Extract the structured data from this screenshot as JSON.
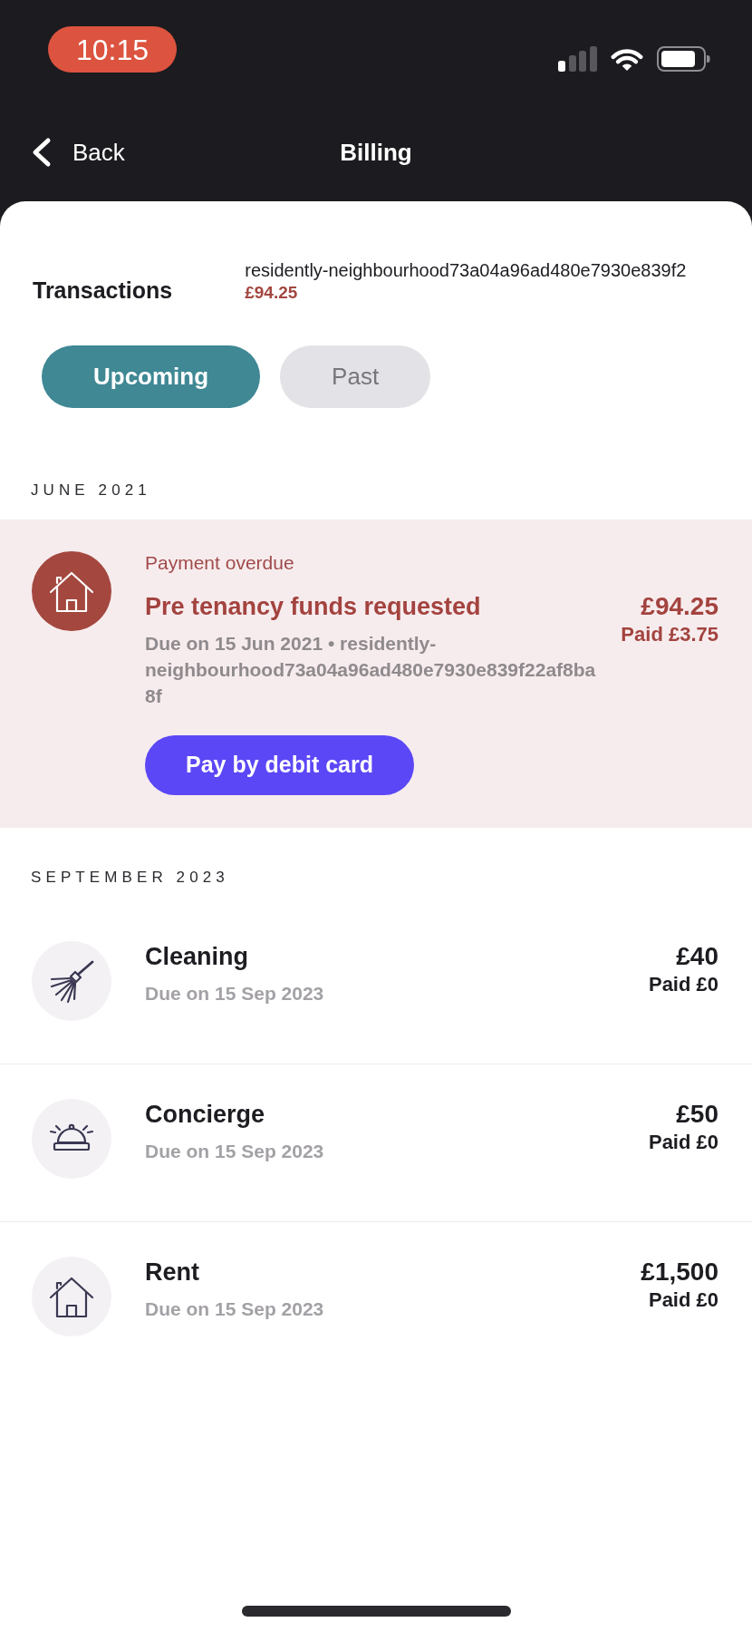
{
  "status_bar": {
    "time": "10:15"
  },
  "nav": {
    "back": "Back",
    "title": "Billing"
  },
  "transactions": {
    "title": "Transactions",
    "reference": "residently-neighbourhood73a04a96ad480e7930e839f2",
    "amount": "£94.25"
  },
  "tabs": [
    {
      "label": "Upcoming",
      "selected": true
    },
    {
      "label": "Past",
      "selected": false
    }
  ],
  "sections": [
    {
      "heading": "JUNE 2021",
      "items": [
        {
          "overdue": true,
          "status": "Payment overdue",
          "title": "Pre tenancy funds requested",
          "due": "Due on 15 Jun 2021 • residently-neighbourhood73a04a96ad480e7930e839f22af8ba8f",
          "amount": "£94.25",
          "paid": "Paid £3.75",
          "action": "Pay by debit card"
        }
      ]
    },
    {
      "heading": "SEPTEMBER 2023",
      "items": [
        {
          "overdue": false,
          "title": "Cleaning",
          "due": "Due on 15 Sep 2023",
          "amount": "£40",
          "paid": "Paid £0"
        },
        {
          "overdue": false,
          "title": "Concierge",
          "due": "Due on 15 Sep 2023",
          "amount": "£50",
          "paid": "Paid £0"
        },
        {
          "overdue": false,
          "title": "Rent",
          "due": "Due on 15 Sep 2023",
          "amount": "£1,500",
          "paid": "Paid £0"
        }
      ]
    }
  ]
}
